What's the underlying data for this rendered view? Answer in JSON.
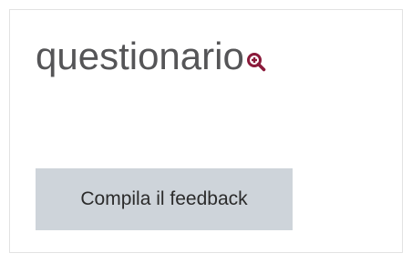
{
  "activity": {
    "title": "questionario",
    "title_icon": "zoom-in-icon",
    "title_icon_color": "#8a1a3a"
  },
  "actions": {
    "feedback_label": "Compila il feedback",
    "button_color": "#ced4da"
  }
}
